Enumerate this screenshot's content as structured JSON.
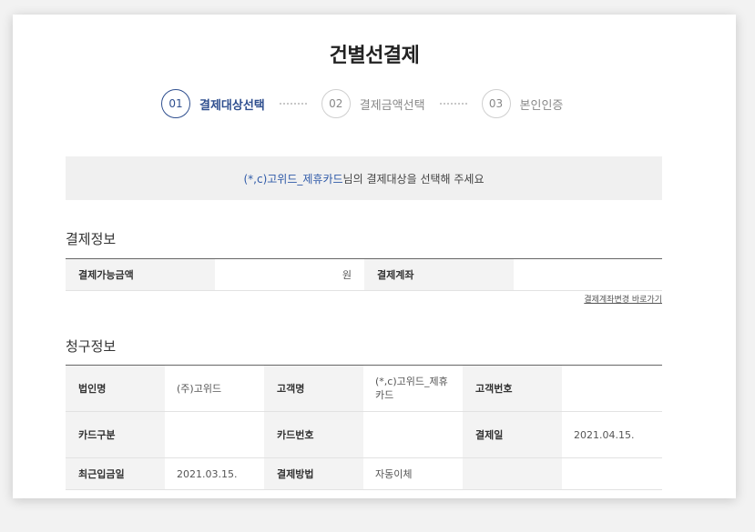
{
  "page": {
    "title": "건별선결제"
  },
  "steps": [
    {
      "number": "01",
      "label": "결제대상선택",
      "active": true
    },
    {
      "number": "02",
      "label": "결제금액선택",
      "active": false
    },
    {
      "number": "03",
      "label": "본인인증",
      "active": false
    }
  ],
  "notice": {
    "highlight": "(*,c)고위드_제휴카드",
    "text": "님의 결제대상을 선택해 주세요"
  },
  "payment_info": {
    "title": "결제정보",
    "amount_label": "결제가능금액",
    "amount_unit": "원",
    "account_label": "결제계좌",
    "account_value": "",
    "change_link": "결제계좌변경 바로가기"
  },
  "billing_info": {
    "title": "청구정보",
    "corp_name_label": "법인명",
    "corp_name": "(주)고위드",
    "customer_name_label": "고객명",
    "customer_name": "(*,c)고위드_제휴카드",
    "customer_no_label": "고객번호",
    "customer_no": "",
    "card_type_label": "카드구분",
    "card_type": "",
    "card_no_label": "카드번호",
    "card_no": "",
    "pay_date_label": "결제일",
    "pay_date": "2021.04.15.",
    "last_deposit_label": "최근입금일",
    "last_deposit": "2021.03.15.",
    "pay_method_label": "결제방법",
    "pay_method": "자동이체"
  },
  "colors": {
    "accent": "#2f4f8f",
    "link": "#2f5aa8",
    "header_bg": "#f3f3f3"
  }
}
